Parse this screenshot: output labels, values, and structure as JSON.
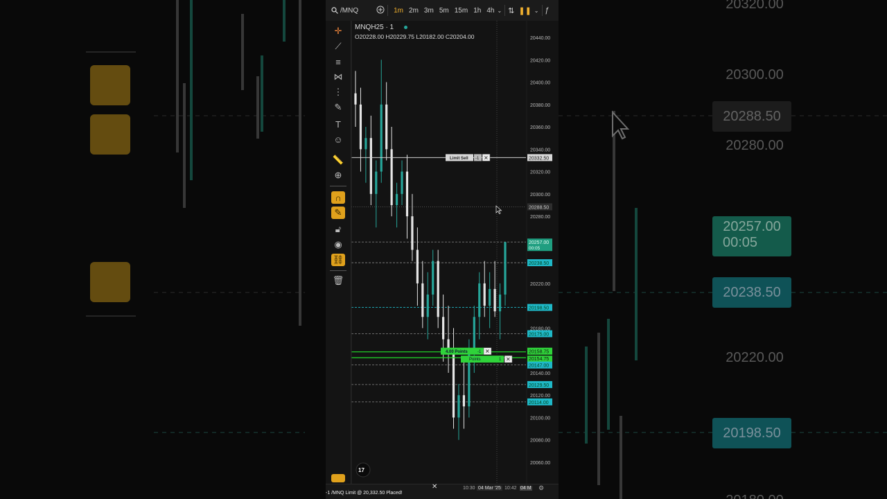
{
  "toolbar_top": {
    "symbol": "/MNQ",
    "timeframes": [
      "1m",
      "2m",
      "3m",
      "5m",
      "15m",
      "1h",
      "4h"
    ],
    "active_timeframe": "1m"
  },
  "legend": {
    "title": "MNQH25 · 1",
    "ohlc": "O20228.00  H20229.75  L20182.00  C20204.00"
  },
  "price_axis": {
    "ticks": [
      "20440.00",
      "20420.00",
      "20400.00",
      "20380.00",
      "20360.00",
      "20340.00",
      "20320.00",
      "20300.00",
      "20280.00",
      "20220.00",
      "20180.00",
      "20140.00",
      "20120.00",
      "20100.00",
      "20080.00",
      "20060.00"
    ]
  },
  "orders": {
    "limit_sell": {
      "label": "Limit Sell",
      "qty": "-1",
      "price": "20332.50"
    },
    "stop_points": {
      "label": "4.00 Points",
      "qty": "-1",
      "price": "20158.75"
    },
    "second": {
      "label": "Points",
      "qty": "1",
      "price": "20154.75"
    }
  },
  "price_labels": [
    {
      "price": "20288.50",
      "style": "hover"
    },
    {
      "price": "20257.00",
      "sub": "00:05",
      "style": "last"
    },
    {
      "price": "20238.50",
      "style": "cyan"
    },
    {
      "price": "20198.50",
      "style": "cyan"
    },
    {
      "price": "20175.00",
      "style": "cyan"
    },
    {
      "price": "20147.00",
      "style": "cyan"
    },
    {
      "price": "20129.50",
      "style": "cyan"
    },
    {
      "price": "20114.00",
      "style": "cyan"
    }
  ],
  "time_axis": {
    "labels": [
      "10:30",
      "04 Mar '25",
      "10:42",
      "04 M"
    ]
  },
  "toast": {
    "text": "-1 /MNQ Limit @ 20,332.50 Placed!"
  },
  "background": {
    "right_labels": [
      "20320.00",
      "20300.00",
      "20288.50",
      "20280.00",
      "20257.00",
      "00:05",
      "20238.50",
      "20220.00",
      "20198.50",
      "20180.00"
    ]
  },
  "colors": {
    "accent": "#f0b02f",
    "up": "#26a69a",
    "down": "#e6e6e6",
    "cyan": "#1fb8c7",
    "green": "#22e02a"
  },
  "chart_data": {
    "type": "candlestick",
    "y_range": [
      20050,
      20450
    ],
    "candles": [
      [
        20390,
        20410,
        20360,
        20380
      ],
      [
        20380,
        20395,
        20320,
        20340
      ],
      [
        20340,
        20360,
        20310,
        20350
      ],
      [
        20350,
        20370,
        20290,
        20300
      ],
      [
        20300,
        20330,
        20270,
        20320
      ],
      [
        20320,
        20420,
        20310,
        20380
      ],
      [
        20380,
        20400,
        20330,
        20340
      ],
      [
        20340,
        20360,
        20280,
        20290
      ],
      [
        20290,
        20310,
        20270,
        20300
      ],
      [
        20300,
        20330,
        20290,
        20320
      ],
      [
        20320,
        20335,
        20260,
        20280
      ],
      [
        20280,
        20300,
        20240,
        20250
      ],
      [
        20250,
        20270,
        20200,
        20220
      ],
      [
        20220,
        20240,
        20180,
        20190
      ],
      [
        20190,
        20230,
        20170,
        20210
      ],
      [
        20210,
        20250,
        20200,
        20240
      ],
      [
        20240,
        20250,
        20180,
        20190
      ],
      [
        20190,
        20210,
        20150,
        20170
      ],
      [
        20170,
        20200,
        20140,
        20160
      ],
      [
        20160,
        20180,
        20090,
        20100
      ],
      [
        20100,
        20130,
        20080,
        20120
      ],
      [
        20120,
        20150,
        20090,
        20110
      ],
      [
        20110,
        20170,
        20100,
        20160
      ],
      [
        20160,
        20200,
        20140,
        20190
      ],
      [
        20190,
        20230,
        20170,
        20220
      ],
      [
        20220,
        20240,
        20190,
        20200
      ],
      [
        20200,
        20230,
        20180,
        20215
      ],
      [
        20215,
        20240,
        20190,
        20195
      ],
      [
        20195,
        20220,
        20170,
        20210
      ],
      [
        20210,
        20250,
        20200,
        20257
      ]
    ]
  }
}
